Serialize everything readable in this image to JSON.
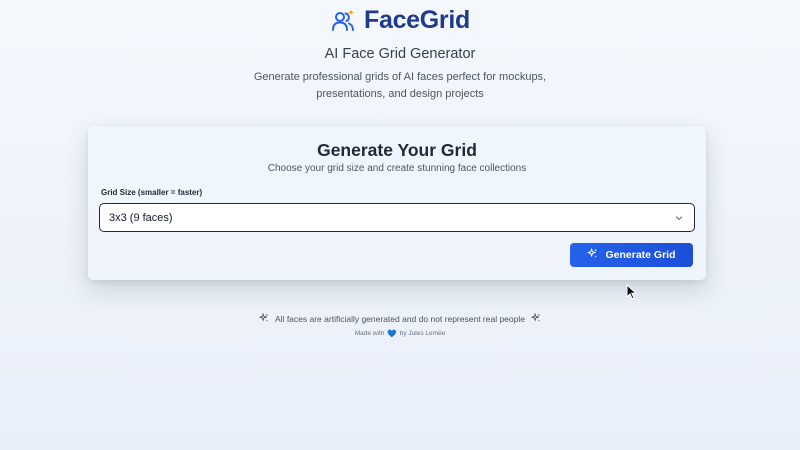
{
  "header": {
    "brand_name": "FaceGrid",
    "brand_icon": "users-sparkle-icon",
    "subtitle": "AI Face Grid Generator",
    "description": "Generate professional grids of AI faces perfect for mockups, presentations, and design projects"
  },
  "card": {
    "title": "Generate Your Grid",
    "subtitle": "Choose your grid size and create stunning face collections",
    "grid_size_label": "Grid Size (smaller = faster)",
    "grid_size_value": "3x3 (9 faces)",
    "generate_label": "Generate Grid"
  },
  "footer": {
    "disclaimer": "All faces are artificially generated and do not represent real people",
    "made_with_prefix": "Made with",
    "made_with_suffix": "by Jules Lemée",
    "heart": "💙"
  },
  "colors": {
    "brand": "#1e3a8a",
    "accent": "#2563eb",
    "background": "#eef3fb"
  }
}
